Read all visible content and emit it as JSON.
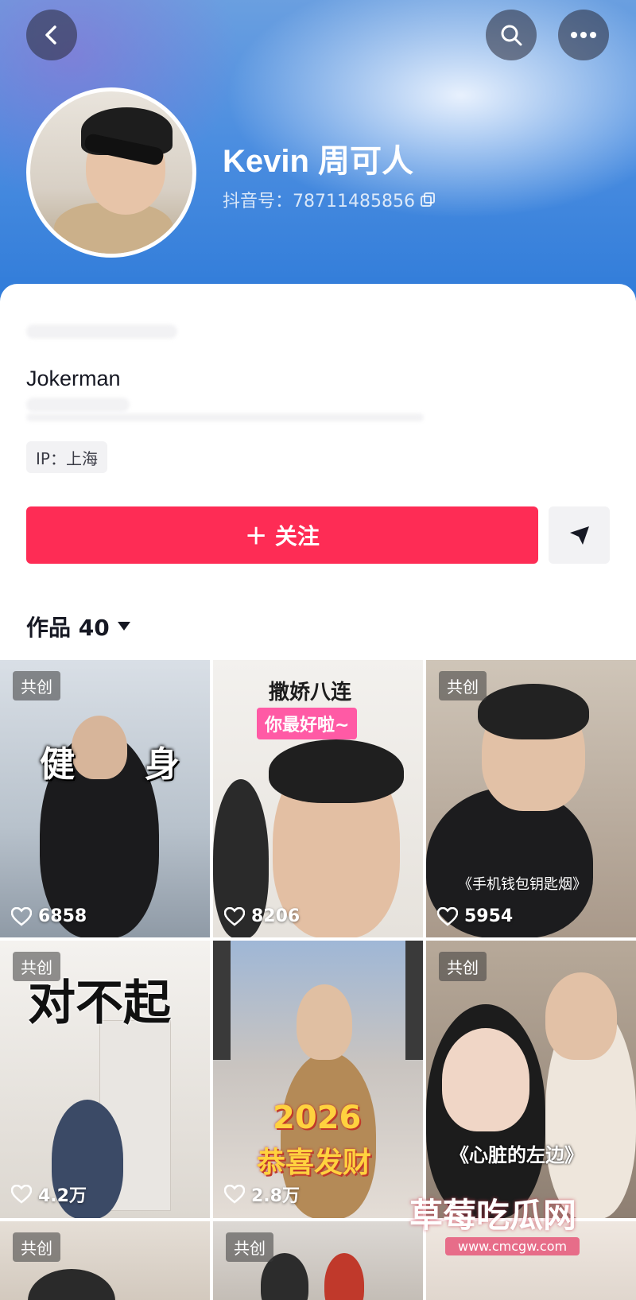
{
  "profile": {
    "name": "Kevin 周可人",
    "uid": "抖音号：78711485856",
    "bio": "Jokerman",
    "ip": "IP：上海"
  },
  "actions": {
    "follow_label": "＋ 关注"
  },
  "works": {
    "label": "作品 40"
  },
  "grid": [
    {
      "tag": "共创",
      "likes": "6858",
      "overlay": "健　　身"
    },
    {
      "tag": "",
      "likes": "8206",
      "overlay": "撒娇八连",
      "overlay2": "你最好啦~"
    },
    {
      "tag": "共创",
      "likes": "5954",
      "overlay": "《手机钱包钥匙烟》"
    },
    {
      "tag": "共创",
      "likes": "4.2万",
      "overlay": "对不起"
    },
    {
      "tag": "",
      "likes": "2.8万",
      "overlay": "2026",
      "overlay2": "恭喜发财"
    },
    {
      "tag": "共创",
      "likes": "",
      "overlay": "《心脏的左边》"
    },
    {
      "tag": "共创",
      "likes": ""
    },
    {
      "tag": "共创",
      "likes": ""
    }
  ],
  "watermark": {
    "text": "草莓吃瓜网",
    "url": "www.cmcgw.com"
  },
  "colors": {
    "accent": "#fe2c55",
    "banner": "#4c8ee0"
  }
}
